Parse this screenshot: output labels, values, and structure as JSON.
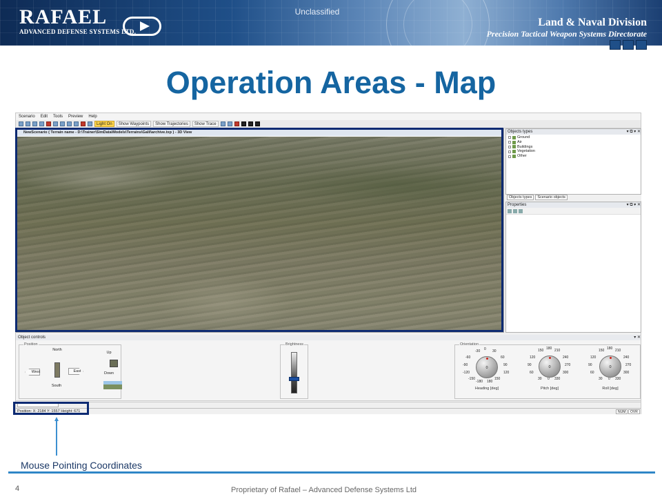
{
  "header": {
    "classification": "Unclassified",
    "logo_word": "RAFAEL",
    "logo_subtitle": "ADVANCED DEFENSE SYSTEMS LTD.",
    "division": "Land & Naval Division",
    "directorate": "Precision Tactical Weapon Systems Directorate"
  },
  "slide": {
    "title": "Operation Areas - Map",
    "annotation": "Mouse Pointing Coordinates",
    "page_number": "4",
    "footer": "Proprietary of Rafael – Advanced Defense Systems Ltd"
  },
  "app": {
    "menu": [
      "Scenario",
      "Edit",
      "Tools",
      "Preview",
      "Help"
    ],
    "toolbar": {
      "light_on": "Light On",
      "show_waypoints": "Show Waypoints",
      "show_trajectories": "Show Trajectories",
      "show_trace": "Show Trace"
    },
    "view_title": "NewScenario ( Terrain name - D:\\Trainer\\SimData\\Models\\Terrains\\Galil\\archive.txp ) - 3D View",
    "objects_panel": {
      "title": "Objects types",
      "items": [
        "Ground",
        "Air",
        "Buildings",
        "Vegetation",
        "Other"
      ],
      "tabs": [
        "Objects types",
        "Scenario objects"
      ]
    },
    "properties_title": "Properties",
    "object_controls": {
      "title": "Object controls",
      "position_label": "Position",
      "north": "North",
      "south": "South",
      "west": "West",
      "east": "East",
      "up": "Up",
      "down": "Down",
      "brightness_label": "Brightness",
      "brightness_level": 0.35,
      "orientation_label": "Orientation",
      "heading": {
        "label": "Heading [deg]",
        "value": "0",
        "ticks": [
          "-30",
          "0",
          "30",
          "-60",
          "60",
          "-90",
          "90",
          "-120",
          "120",
          "-150",
          "150",
          "-180",
          "180"
        ]
      },
      "pitch": {
        "label": "Pitch [deg]",
        "value": "0",
        "ticks": [
          "150",
          "180",
          "210",
          "120",
          "240",
          "90",
          "270",
          "60",
          "300",
          "30",
          "0",
          "330"
        ]
      },
      "roll": {
        "label": "Roll [deg]",
        "value": "0",
        "ticks": [
          "150",
          "180",
          "210",
          "120",
          "240",
          "90",
          "270",
          "60",
          "300",
          "30",
          "0",
          "330"
        ]
      }
    },
    "status": {
      "coordinates": "Position: X: 2184 Y: 1557 Height: 671",
      "num": "NUM",
      "ovr": "OVR"
    }
  },
  "colors": {
    "title": "#1565a1",
    "highlight": "#0c2a72",
    "footer_line": "#2f86c7"
  }
}
